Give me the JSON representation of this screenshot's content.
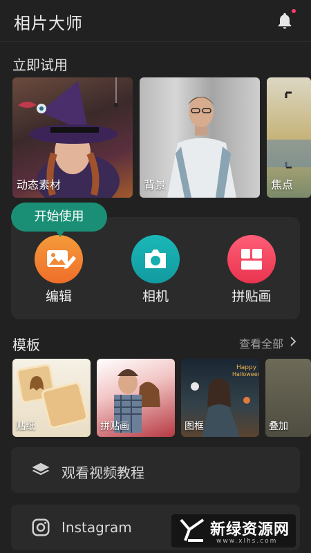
{
  "header": {
    "app_title": "相片大师"
  },
  "try_section": {
    "title": "立即试用",
    "cards": [
      {
        "label": "动态素材"
      },
      {
        "label": "背景"
      },
      {
        "label": "焦点"
      }
    ]
  },
  "tooltip": {
    "text": "开始使用"
  },
  "tools": [
    {
      "label": "编辑",
      "icon": "image-edit-icon",
      "color": "#f0832f"
    },
    {
      "label": "相机",
      "icon": "camera-icon",
      "color": "#17aeb0"
    },
    {
      "label": "拼贴画",
      "icon": "collage-icon",
      "color": "#f24a63"
    }
  ],
  "templates": {
    "title": "模板",
    "see_all": "查看全部",
    "items": [
      {
        "label": "贴纸"
      },
      {
        "label": "拼贴画"
      },
      {
        "label": "图框"
      },
      {
        "label": "叠加"
      }
    ]
  },
  "list": [
    {
      "label": "观看视频教程",
      "icon": "layers-icon"
    },
    {
      "label": "Instagram",
      "icon": "instagram-icon"
    }
  ],
  "watermark": {
    "text": "新绿资源网",
    "url": "www.xlhs.com"
  },
  "colors": {
    "background": "#212121",
    "accent_tooltip": "#1a8f75",
    "notification_dot": "#ff3b6b"
  }
}
